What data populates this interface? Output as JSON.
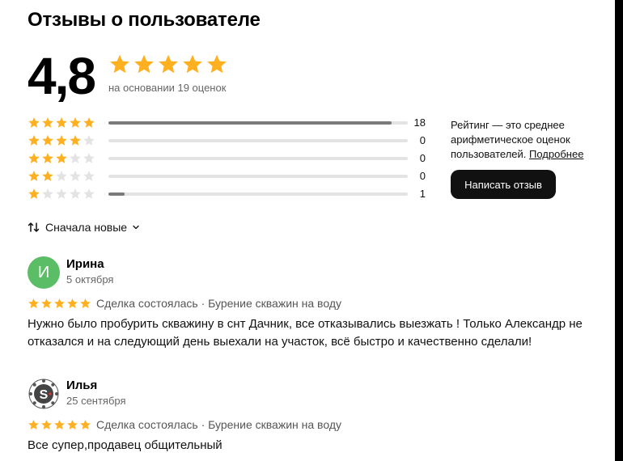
{
  "page": {
    "title": "Отзывы о пользователе"
  },
  "summary": {
    "rating": "4,8",
    "stars": 5,
    "based_on": "на основании 19 оценок"
  },
  "distribution": [
    {
      "stars": 5,
      "count": "18",
      "fraction": 0.947
    },
    {
      "stars": 4,
      "count": "0",
      "fraction": 0
    },
    {
      "stars": 3,
      "count": "0",
      "fraction": 0
    },
    {
      "stars": 2,
      "count": "0",
      "fraction": 0
    },
    {
      "stars": 1,
      "count": "1",
      "fraction": 0.053
    }
  ],
  "info": {
    "text": "Рейтинг — это среднее арифметическое оценок пользователей. ",
    "link": "Подробнее"
  },
  "write_button": "Написать отзыв",
  "sort": {
    "icon": "sort-arrows-icon",
    "label": "Сначала новые"
  },
  "reviews": [
    {
      "avatar_letter": "И",
      "avatar_color": "#5bbd65",
      "name": "Ирина",
      "date": "5 октября",
      "stars": 5,
      "deal": "Сделка состоялась · Бурение скважин на воду",
      "text": "Нужно было пробурить скважину в снт Дачник, все отказывались выезжать ! Только Александр не отказался и на следующий день выехали на участок, всё быстро и качественно сделали!"
    },
    {
      "avatar_logo": "syndicate-logo",
      "name": "Илья",
      "date": "25 сентября",
      "stars": 5,
      "deal": "Сделка состоялась · Бурение скважин на воду",
      "text": "Все супер,продавец общительный"
    }
  ],
  "colors": {
    "star_filled": "#ffb021",
    "star_empty": "#e3e3e3",
    "button_bg": "#111111"
  }
}
